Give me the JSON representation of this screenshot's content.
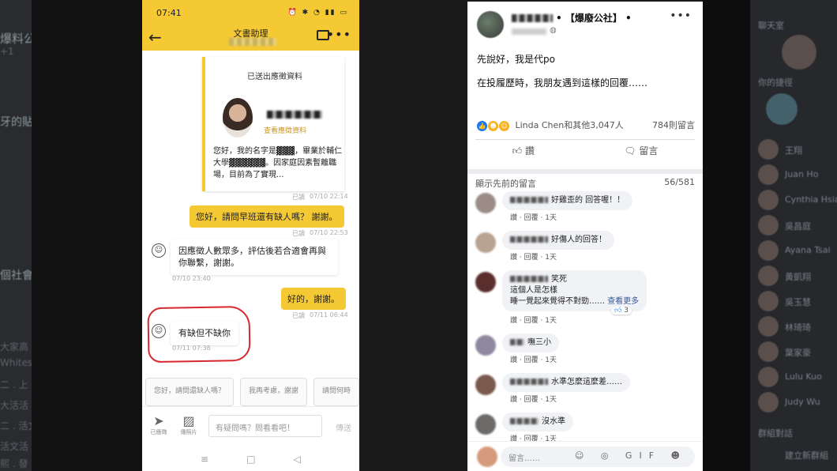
{
  "background": {
    "left_fragments": [
      "爆料公",
      "+1",
      "牙的貼",
      "個社會",
      "大家高",
      "Whites",
      "二 . 上",
      "大活活",
      "二 . 活文",
      "活文活",
      "熙 . 發"
    ],
    "right_fragments": [
      "聊天室",
      "你的捷徑",
      "王"
    ],
    "right_names": [
      "王翔",
      "Juan Ho",
      "Cynthia Hsiao",
      "吳昌庭",
      "Ayana Tsai",
      "黃凱翔",
      "吳玉慧",
      "林琦琦",
      "葉家豪",
      "Lulu Kuo",
      "Judy Wu",
      "群組對話",
      "建立新群組"
    ]
  },
  "phone": {
    "status_time": "07:41",
    "status_icons": "⏰ ✱ ◔ ▮▮ ▭",
    "header_title": "文書助理",
    "back_glyph": "←",
    "more_glyph": "•••",
    "card": {
      "title": "已送出應徵資料",
      "link": "查看應徵資料",
      "text": "您好，我的名字是▓▓▓，畢業於輔仁大學▓▓▓▓▓▓。因家庭因素暫離職場，目前為了實現...",
      "read": "已讀",
      "time": "07/10 22:14"
    },
    "messages": [
      {
        "from": "me",
        "text": "您好，請問早班還有缺人嗎？ 謝謝。",
        "read": "已讀",
        "time": "07/10 22:53"
      },
      {
        "from": "them",
        "text": "因應徵人數眾多，評估後若合適會再與你聯繫，謝謝。",
        "time": "07/10 23:40"
      },
      {
        "from": "me",
        "text": "好的，謝謝。",
        "read": "已讀",
        "time": "07/11 06:44"
      },
      {
        "from": "them",
        "text": "有缺但不缺你",
        "time": "07/11 07:38"
      }
    ],
    "quick_replies": [
      "您好，請問還缺人嗎？",
      "我再考慮，謝謝",
      "請問何時"
    ],
    "input": {
      "upload_label": "已應徵",
      "photo_label": "傳照片",
      "placeholder": "有疑問嗎？問看看吧！",
      "send_label": "傳送"
    },
    "nav": [
      "≡",
      "□",
      "◁"
    ]
  },
  "fb": {
    "group_name": "• 【爆廢公社】 •",
    "post_lines": [
      "先說好，我是代po",
      "在投履歷時，我朋友遇到這樣的回覆……"
    ],
    "reactions_text": "Linda Chen和其他3,047人",
    "comments_count": "784則留言",
    "like_label": "讚",
    "comment_label": "留言",
    "show_prev": "顯示先前的留言",
    "pager": "56/581",
    "like_word": "讚",
    "reply_word": "回覆",
    "comments": [
      {
        "text": "好雞歪的 回答喔！！",
        "time": "1天"
      },
      {
        "text": "好傷人的回答！",
        "time": "1天"
      },
      {
        "line1": "笑死",
        "line2": "這個人是怎樣",
        "line3": "睡一覺起來覺得不對勁……",
        "more": "查看更多",
        "time": "1天",
        "badge": "3"
      },
      {
        "text": "嘸三小",
        "time": "1天"
      },
      {
        "text": "水準怎麼這麼差……",
        "time": "1天"
      },
      {
        "text": "沒水準",
        "time": "1天"
      }
    ],
    "write_placeholder": "留言……",
    "write_icons": "☺ ◎ GIF ☻"
  },
  "colors": {
    "yellow": "#f5c934",
    "red_circle": "#d8282f",
    "fb_link": "#385898"
  }
}
